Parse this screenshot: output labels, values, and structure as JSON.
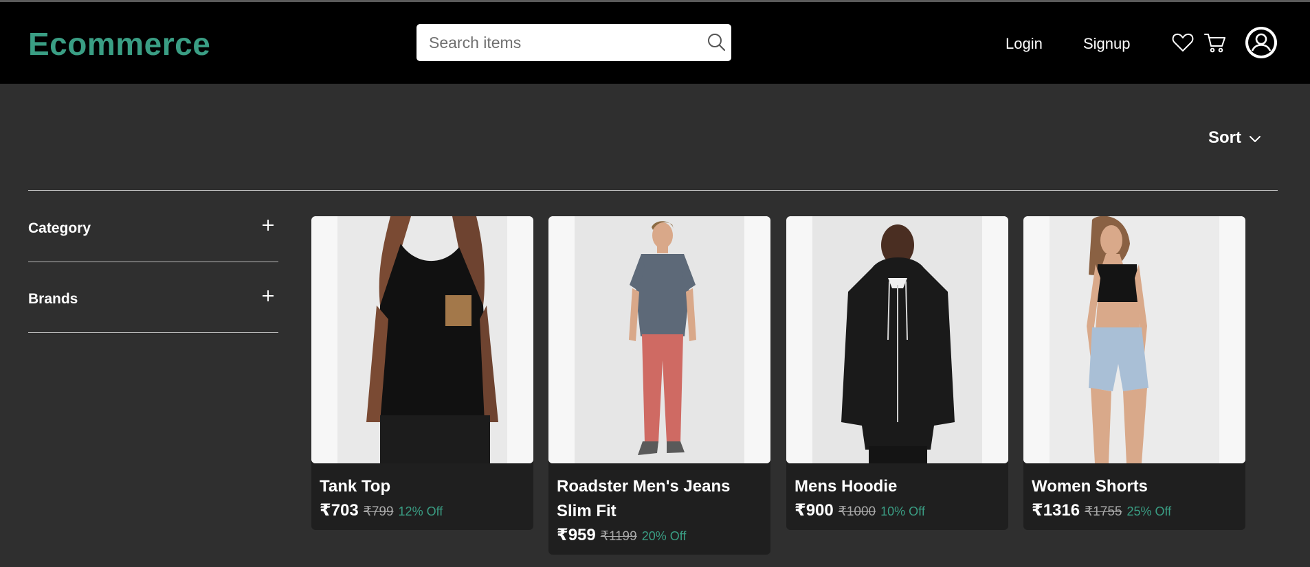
{
  "header": {
    "logo": "Ecommerce",
    "search_placeholder": "Search items",
    "login_label": "Login",
    "signup_label": "Signup",
    "icons": [
      "search-icon",
      "heart-icon",
      "cart-icon",
      "user-circle-icon"
    ]
  },
  "toolbar": {
    "sort_label": "Sort"
  },
  "filters": [
    {
      "label": "Category"
    },
    {
      "label": "Brands"
    }
  ],
  "products": [
    {
      "name": "Tank Top",
      "price": "₹703",
      "mrp": "₹799",
      "discount": "12% Off"
    },
    {
      "name": "Roadster Men's Jeans Slim Fit",
      "price": "₹959",
      "mrp": "₹1199",
      "discount": "20% Off"
    },
    {
      "name": "Mens Hoodie",
      "price": "₹900",
      "mrp": "₹1000",
      "discount": "10% Off"
    },
    {
      "name": "Women Shorts",
      "price": "₹1316",
      "mrp": "₹1755",
      "discount": "25% Off"
    }
  ],
  "colors": {
    "accent": "#3a9e84",
    "header_bg": "#000000",
    "page_bg": "#2f2f2f",
    "card_bg": "#1f1f1f"
  }
}
